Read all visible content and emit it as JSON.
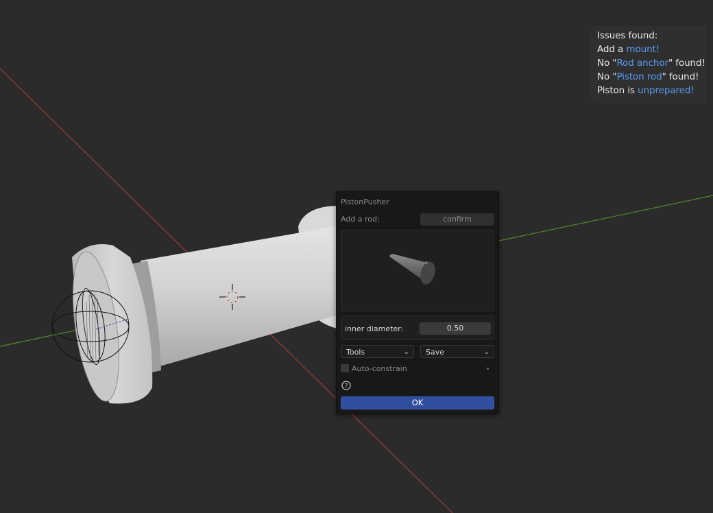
{
  "issues": {
    "title": "Issues found:",
    "line1_pre": "Add a ",
    "line1_hl": "mount!",
    "line2_pre": "No \"",
    "line2_hl": "Rod anchor",
    "line2_post": "\" found!",
    "line3_pre": "No \"",
    "line3_hl": "Piston rod",
    "line3_post": "\" found!",
    "line4_pre": "Piston is ",
    "line4_hl": "unprepared!"
  },
  "panel": {
    "title": "PistonPusher",
    "add_rod_label": "Add a rod:",
    "confirm_label": "confirm",
    "preview_icon": "cone-preview",
    "inner_diameter_label": "inner diameter:",
    "inner_diameter_value": "0.50",
    "tools_dropdown": "Tools",
    "save_dropdown": "Save",
    "auto_constrain_label": "Auto-constrain",
    "auto_constrain_checked": false,
    "help_icon": "question-icon",
    "ok_label": "OK"
  },
  "colors": {
    "highlight": "#5b9cf2",
    "ok_button": "#2f4f9e",
    "x_axis": "#a03a3a",
    "y_axis": "#5a8a2a"
  }
}
